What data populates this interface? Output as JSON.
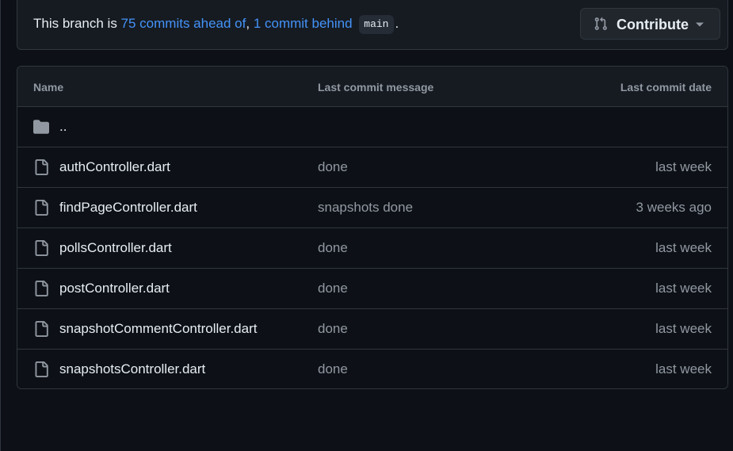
{
  "branch": {
    "prefix": "This branch is ",
    "ahead_link": "75 commits ahead of",
    "separator": ", ",
    "behind_link": "1 commit behind",
    "base_branch": "main",
    "suffix": "."
  },
  "contribute": {
    "label": "Contribute",
    "icon": "git-pull-request-icon",
    "caret_icon": "triangle-down-icon"
  },
  "table": {
    "headers": {
      "name": "Name",
      "message": "Last commit message",
      "date": "Last commit date"
    },
    "parent_dir": {
      "name": "..",
      "icon": "folder-icon"
    },
    "files": [
      {
        "name": "authController.dart",
        "message": "done",
        "date": "last week",
        "icon": "file-icon"
      },
      {
        "name": "findPageController.dart",
        "message": "snapshots done",
        "date": "3 weeks ago",
        "icon": "file-icon"
      },
      {
        "name": "pollsController.dart",
        "message": "done",
        "date": "last week",
        "icon": "file-icon"
      },
      {
        "name": "postController.dart",
        "message": "done",
        "date": "last week",
        "icon": "file-icon"
      },
      {
        "name": "snapshotCommentController.dart",
        "message": "done",
        "date": "last week",
        "icon": "file-icon"
      },
      {
        "name": "snapshotsController.dart",
        "message": "done",
        "date": "last week",
        "icon": "file-icon"
      }
    ]
  },
  "colors": {
    "background": "#0d1117",
    "surface": "#161b22",
    "border": "#30363d",
    "link": "#4493f8",
    "text": "#e6edf3",
    "muted": "#9198a1"
  }
}
